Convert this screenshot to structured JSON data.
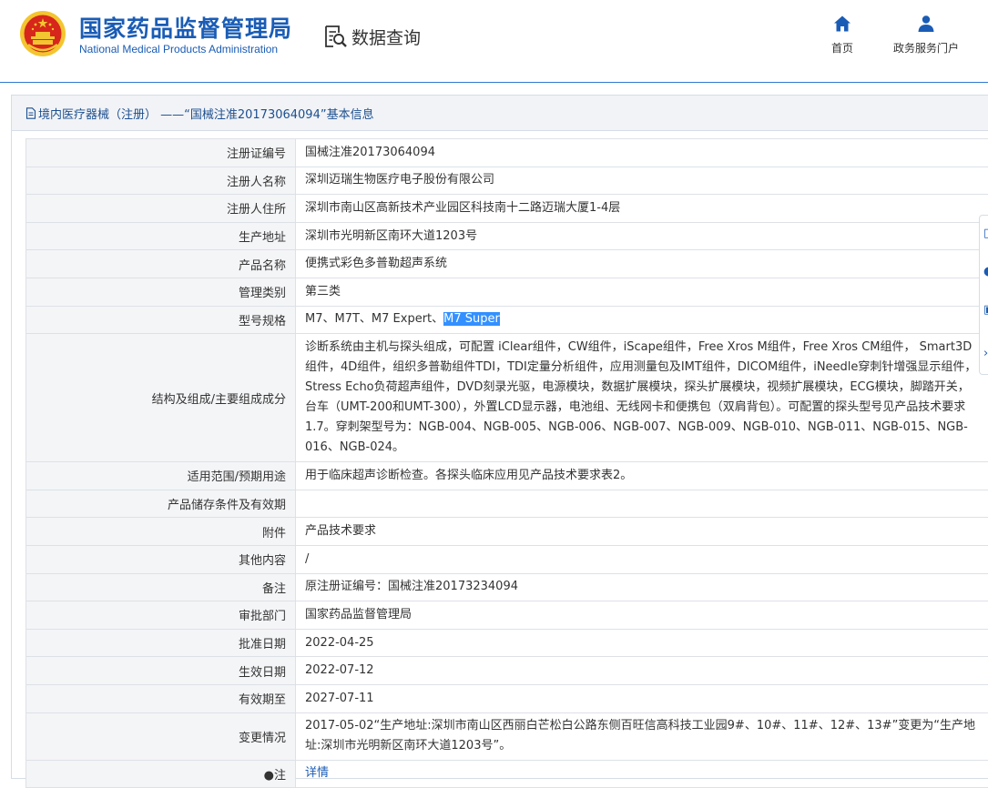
{
  "header": {
    "brand_cn": "国家药品监督管理局",
    "brand_en": "National Medical Products Administration",
    "query_label": "数据查询",
    "nav_home": "首页",
    "nav_portal": "政务服务门户"
  },
  "panel": {
    "title": "境内医疗器械（注册） ——“国械注准20173064094”基本信息"
  },
  "rows": [
    {
      "label": "注册证编号",
      "value": "国械注准20173064094"
    },
    {
      "label": "注册人名称",
      "value": "深圳迈瑞生物医疗电子股份有限公司"
    },
    {
      "label": "注册人住所",
      "value": "深圳市南山区高新技术产业园区科技南十二路迈瑞大厦1-4层"
    },
    {
      "label": "生产地址",
      "value": "深圳市光明新区南环大道1203号"
    },
    {
      "label": "产品名称",
      "value": "便携式彩色多普勒超声系统"
    },
    {
      "label": "管理类别",
      "value": "第三类"
    },
    {
      "label": "型号规格",
      "value_prefix": "M7、M7T、M7 Expert、",
      "value_highlight": "M7 Super"
    },
    {
      "label": "结构及组成/主要组成成分",
      "value": "诊断系统由主机与探头组成，可配置 iClear组件，CW组件，iScape组件，Free Xros M组件，Free Xros CM组件， Smart3D组件，4D组件，组织多普勒组件TDI，TDI定量分析组件，应用测量包及IMT组件，DICOM组件，iNeedle穿刺针增强显示组件，Stress Echo负荷超声组件，DVD刻录光驱，电源模块，数据扩展模块，探头扩展模块，视频扩展模块，ECG模块，脚踏开关，台车（UMT-200和UMT-300），外置LCD显示器，电池组、无线网卡和便携包（双肩背包）。可配置的探头型号见产品技术要求1.7。穿刺架型号为：NGB-004、NGB-005、NGB-006、NGB-007、NGB-009、NGB-010、NGB-011、NGB-015、NGB-016、NGB-024。"
    },
    {
      "label": "适用范围/预期用途",
      "value": "用于临床超声诊断检查。各探头临床应用见产品技术要求表2。"
    },
    {
      "label": "产品储存条件及有效期",
      "value": ""
    },
    {
      "label": "附件",
      "value": "产品技术要求"
    },
    {
      "label": "其他内容",
      "value": "/"
    },
    {
      "label": "备注",
      "value": "原注册证编号：国械注准20173234094"
    },
    {
      "label": "审批部门",
      "value": "国家药品监督管理局"
    },
    {
      "label": "批准日期",
      "value": "2022-04-25"
    },
    {
      "label": "生效日期",
      "value": "2022-07-12"
    },
    {
      "label": "有效期至",
      "value": "2027-07-11"
    },
    {
      "label": "变更情况",
      "value": "2017-05-02“生产地址:深圳市南山区西丽白芒松白公路东侧百旺信高科技工业园9#、10#、11#、12#、13#”变更为“生产地址:深圳市光明新区南环大道1203号”。"
    },
    {
      "label": "注",
      "value": "详情"
    }
  ],
  "colors": {
    "brand_blue": "#1a5cb5",
    "emblem_red": "#d7261b",
    "emblem_gold": "#f3c530",
    "selection": "#3390ff"
  },
  "icons": {
    "emblem": "national-emblem",
    "query": "document-search-icon",
    "home": "home-icon",
    "portal": "user-icon",
    "panel": "document-icon",
    "note": "pin-icon"
  }
}
